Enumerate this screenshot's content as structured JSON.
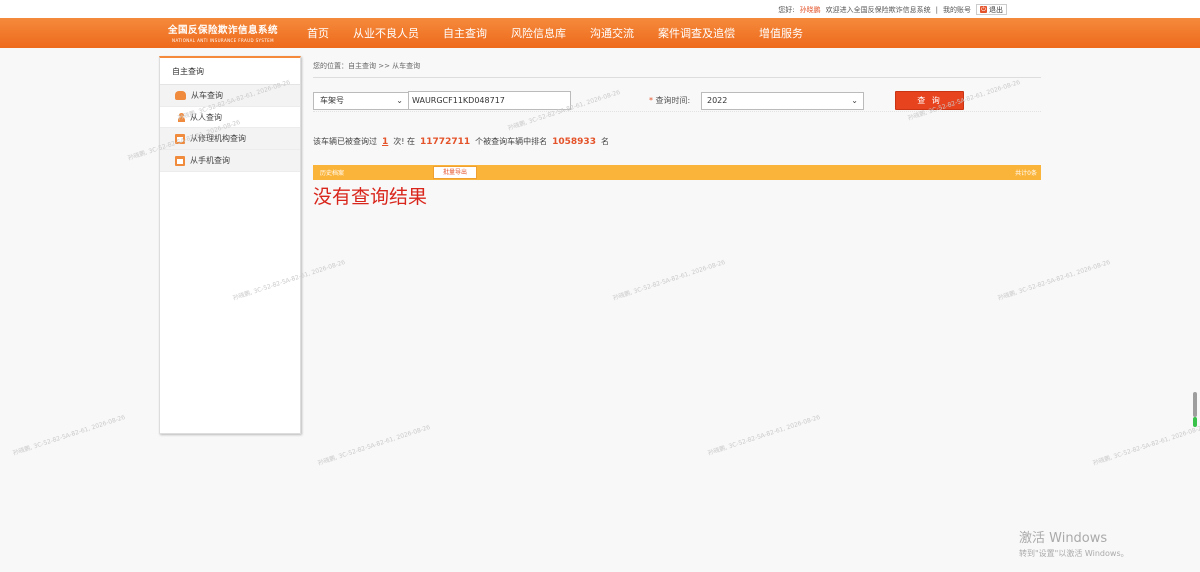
{
  "topbar": {
    "greeting": "您好:",
    "username": "孙晓鹏",
    "welcome": "欢迎进入全国反保险欺诈信息系统",
    "separator": "|",
    "my_account": "我的账号",
    "logout": "退出"
  },
  "logo": {
    "cn": "全国反保险欺诈信息系统",
    "en": "NATIONAL ANTI INSURANCE FRAUD SYSTEM"
  },
  "nav": [
    "首页",
    "从业不良人员",
    "自主查询",
    "风险信息库",
    "沟通交流",
    "案件调查及追偿",
    "增值服务"
  ],
  "sidebar": {
    "title": "自主查询",
    "items": [
      {
        "label": "从车查询",
        "icon": "car-icon"
      },
      {
        "label": "从人查询",
        "icon": "person-icon"
      },
      {
        "label": "从修理机构查询",
        "icon": "repair-icon"
      },
      {
        "label": "从手机查询",
        "icon": "phone-icon"
      }
    ]
  },
  "breadcrumb": "您的位置：自主查询 >> 从车查询",
  "search": {
    "type_value": "车架号",
    "vin_value": "WAURGCF11KD048717",
    "time_required": "*",
    "time_label": "查询时间:",
    "year_value": "2022",
    "button_label": "查 询"
  },
  "stats": {
    "prefix": "该车辆已被查询过",
    "times": "1",
    "mid1": "次! 在",
    "total": "11772711",
    "mid2": "个被查询车辆中排名",
    "rank": "1058933",
    "suffix": "名"
  },
  "result_bar": {
    "history": "历史档案",
    "export": "批量导出",
    "total": "共计0条"
  },
  "no_result": "没有查询结果",
  "watermark": "孙晓鹏, 3C-52-82-5A-82-61, 2026-08-26",
  "windows": {
    "title": "激活 Windows",
    "subtitle": "转到\"设置\"以激活 Windows。"
  }
}
